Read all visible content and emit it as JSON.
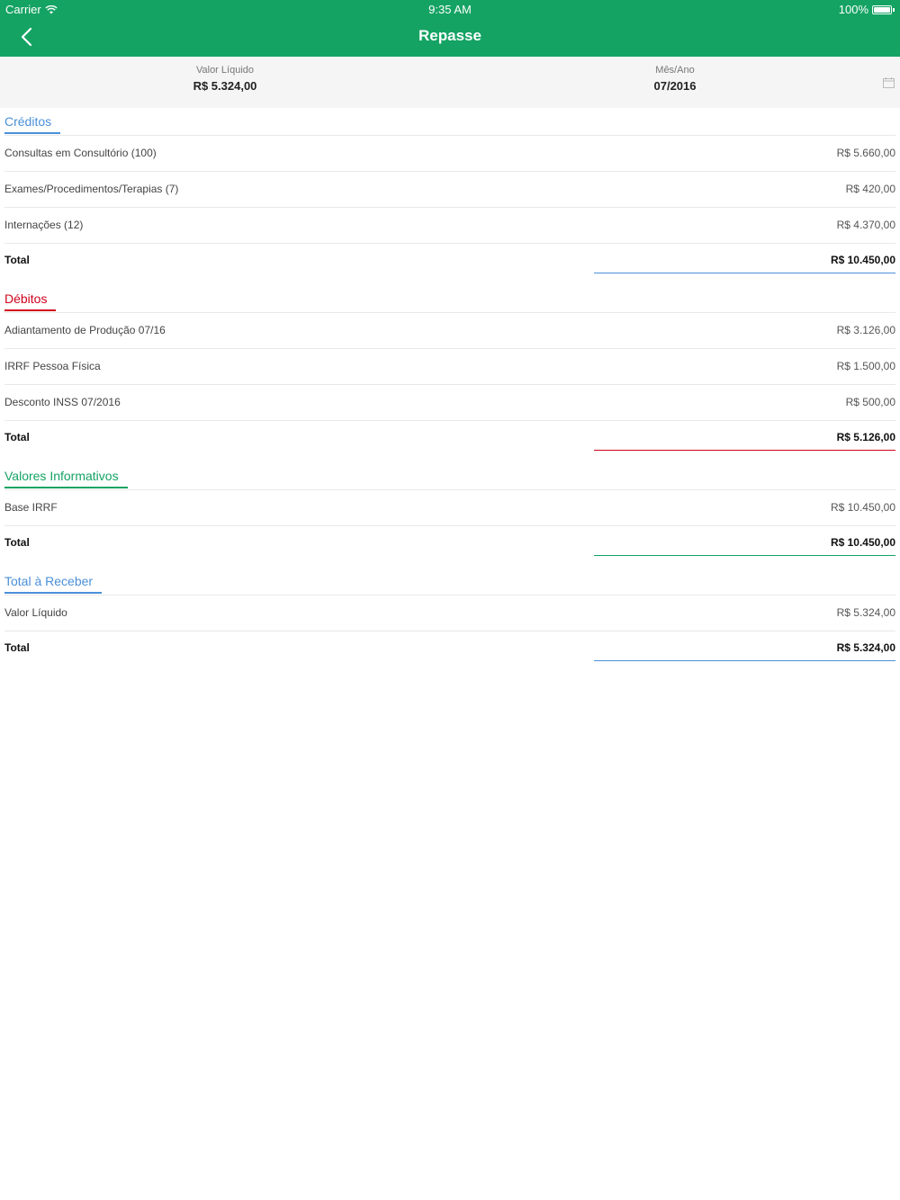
{
  "status": {
    "carrier": "Carrier",
    "time": "9:35 AM",
    "battery": "100%"
  },
  "nav": {
    "title": "Repasse"
  },
  "summary": {
    "net_label": "Valor Líquido",
    "net_value": "R$ 5.324,00",
    "period_label": "Mês/Ano",
    "period_value": "07/2016"
  },
  "colors": {
    "header": "#14a363",
    "creditos": "#4a90d9",
    "debitos": "#d0021b",
    "informativos": "#14a363",
    "receber": "#4a90d9"
  },
  "sections": {
    "creditos": {
      "title": "Créditos",
      "rows": [
        {
          "label": "Consultas em Consultório (100)",
          "value": "R$ 5.660,00"
        },
        {
          "label": "Exames/Procedimentos/Terapias (7)",
          "value": "R$ 420,00"
        },
        {
          "label": "Internações (12)",
          "value": "R$ 4.370,00"
        }
      ],
      "total_label": "Total",
      "total_value": "R$ 10.450,00"
    },
    "debitos": {
      "title": "Débitos",
      "rows": [
        {
          "label": "Adiantamento de Produção  07/16",
          "value": "R$ 3.126,00"
        },
        {
          "label": "IRRF Pessoa Física",
          "value": "R$ 1.500,00"
        },
        {
          "label": "Desconto INSS 07/2016",
          "value": "R$ 500,00"
        }
      ],
      "total_label": "Total",
      "total_value": "R$ 5.126,00"
    },
    "informativos": {
      "title": "Valores Informativos",
      "rows": [
        {
          "label": "Base IRRF",
          "value": "R$ 10.450,00"
        }
      ],
      "total_label": "Total",
      "total_value": "R$ 10.450,00"
    },
    "receber": {
      "title": "Total à Receber",
      "rows": [
        {
          "label": "Valor Líquido",
          "value": "R$ 5.324,00"
        }
      ],
      "total_label": "Total",
      "total_value": "R$ 5.324,00"
    }
  }
}
